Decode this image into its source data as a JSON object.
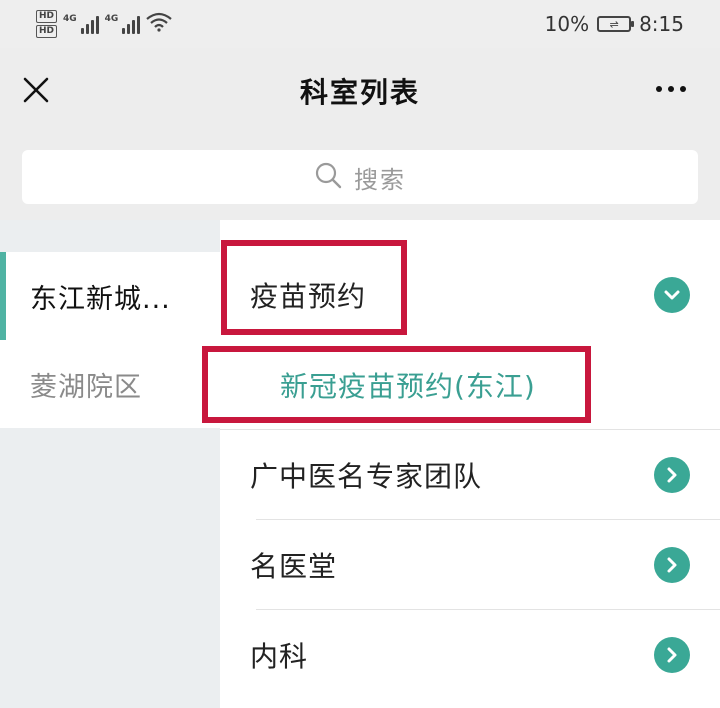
{
  "status_bar": {
    "hd1": "HD",
    "hd2": "HD",
    "net1": "4G",
    "net2": "4G",
    "battery_text": "10%",
    "time": "8:15"
  },
  "nav": {
    "title": "科室列表",
    "close_icon": "close-icon",
    "more_icon": "more-icon"
  },
  "search": {
    "placeholder": "搜索",
    "icon": "search-icon"
  },
  "campuses": [
    {
      "label": "东江新城...",
      "active": true
    },
    {
      "label": "菱湖院区",
      "active": false
    }
  ],
  "departments": [
    {
      "label": "疫苗预约",
      "icon": "chevron-down-circle-icon",
      "expanded": true,
      "children": [
        {
          "label": "新冠疫苗预约(东江)"
        }
      ]
    },
    {
      "label": "广中医名专家团队",
      "icon": "chevron-right-circle-icon"
    },
    {
      "label": "名医堂",
      "icon": "chevron-right-circle-icon"
    },
    {
      "label": "内科",
      "icon": "chevron-right-circle-icon"
    }
  ],
  "colors": {
    "accent": "#3aa896",
    "highlight": "#c8173d",
    "sub_text": "#3a9f92"
  }
}
